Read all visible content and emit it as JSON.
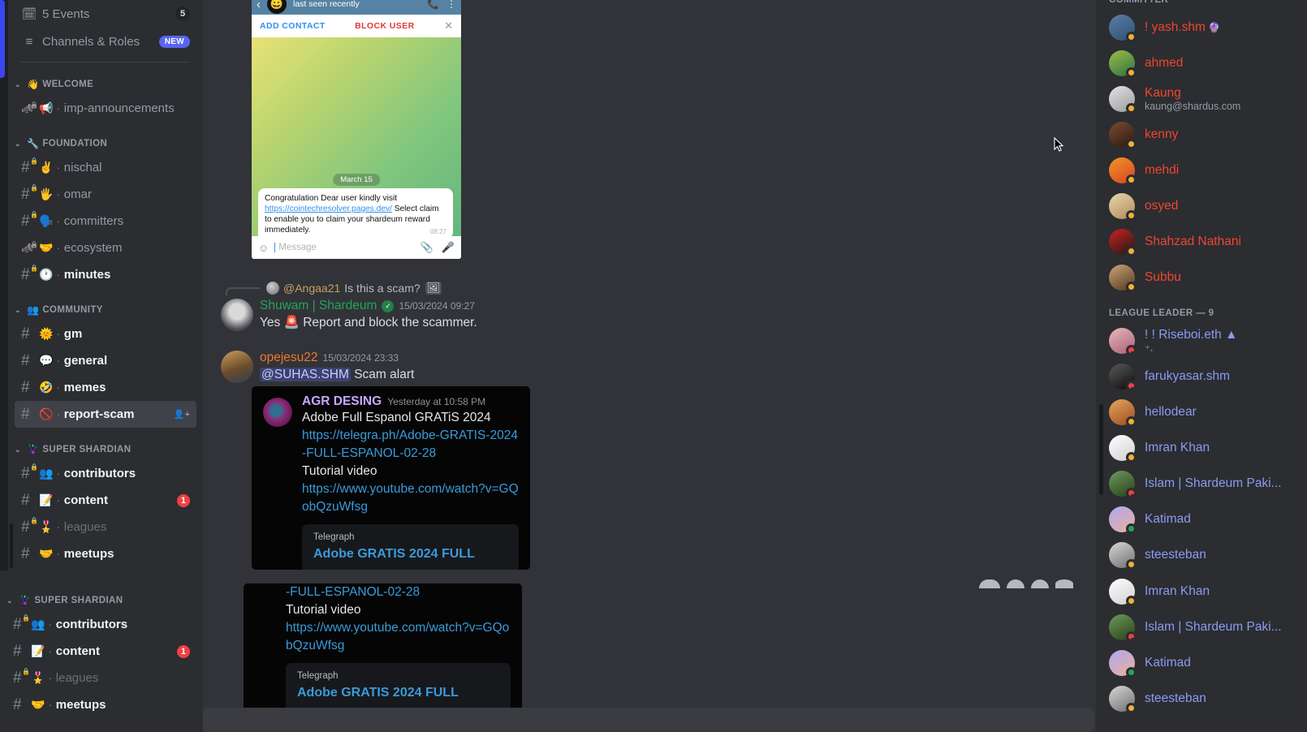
{
  "sidebar": {
    "top_items": [
      {
        "label": "5 Events",
        "icon": "calendar-icon",
        "badge": "5",
        "badge_type": "count"
      },
      {
        "label": "Channels & Roles",
        "icon": "channels-roles-icon",
        "badge": "NEW",
        "badge_type": "new"
      }
    ],
    "categories": [
      {
        "name": "WELCOME",
        "emoji": "👋",
        "channels": [
          {
            "name": "imp-announcements",
            "emoji": "📢",
            "icon": "announcement-channel-icon",
            "locked": true,
            "style": "normal"
          }
        ]
      },
      {
        "name": "FOUNDATION",
        "emoji": "🔧",
        "channels": [
          {
            "name": "nischal",
            "emoji": "✌️",
            "icon": "hash-icon",
            "locked": true,
            "style": "normal"
          },
          {
            "name": "omar",
            "emoji": "🖐️",
            "icon": "hash-icon",
            "locked": true,
            "style": "normal"
          },
          {
            "name": "committers",
            "emoji": "🗣️",
            "icon": "hash-icon",
            "locked": true,
            "style": "normal"
          },
          {
            "name": "ecosystem",
            "emoji": "🤝",
            "icon": "announcement-channel-icon",
            "locked": true,
            "style": "normal"
          },
          {
            "name": "minutes",
            "emoji": "🕐",
            "icon": "hash-icon",
            "locked": true,
            "style": "bold"
          }
        ]
      },
      {
        "name": "COMMUNITY",
        "emoji": "👥",
        "channels": [
          {
            "name": "gm",
            "emoji": "🌞",
            "icon": "hash-icon",
            "locked": false,
            "style": "bold"
          },
          {
            "name": "general",
            "emoji": "💬",
            "icon": "hash-icon",
            "locked": false,
            "style": "bold"
          },
          {
            "name": "memes",
            "emoji": "🤣",
            "icon": "hash-icon",
            "locked": false,
            "style": "bold"
          },
          {
            "name": "report-scam",
            "emoji": "🚫",
            "icon": "hash-icon",
            "locked": false,
            "style": "bold",
            "active": true,
            "trailing_icon": "add-member-icon"
          }
        ]
      },
      {
        "name": "SUPER SHARDIAN",
        "emoji": "🦹",
        "channels": [
          {
            "name": "contributors",
            "emoji": "👥",
            "icon": "hash-icon",
            "locked": true,
            "style": "bold"
          },
          {
            "name": "content",
            "emoji": "📝",
            "icon": "hash-icon",
            "locked": false,
            "style": "bold",
            "badge": "1"
          },
          {
            "name": "leagues",
            "emoji": "🎖️",
            "icon": "hash-icon",
            "locked": true,
            "style": "muted"
          },
          {
            "name": "meetups",
            "emoji": "🤝",
            "icon": "hash-icon",
            "locked": false,
            "style": "bold"
          }
        ]
      }
    ],
    "overlay_category": {
      "name": "SUPER SHARDIAN",
      "emoji": "🦹",
      "channels": [
        {
          "name": "contributors",
          "emoji": "👥",
          "icon": "hash-icon",
          "locked": true,
          "style": "bold"
        },
        {
          "name": "content",
          "emoji": "📝",
          "icon": "hash-icon",
          "locked": false,
          "style": "bold",
          "badge": "1"
        },
        {
          "name": "leagues",
          "emoji": "🎖️",
          "icon": "hash-icon",
          "locked": true,
          "style": "muted"
        },
        {
          "name": "meetups",
          "emoji": "🤝",
          "icon": "hash-icon",
          "locked": false,
          "style": "bold"
        }
      ]
    }
  },
  "telegram_screenshot": {
    "header": {
      "status": "last seen recently",
      "back_icon": "back-arrow-icon",
      "call_icon": "phone-icon",
      "menu_icon": "kebab-menu-icon"
    },
    "action_bar": {
      "add_contact": "ADD CONTACT",
      "block_user": "BLOCK USER",
      "close_icon": "close-icon"
    },
    "date_separator": "March 15",
    "message": {
      "text_before": "Congratulation Dear user kindly visit ",
      "link": "https://cointechresolver.pages.dev/",
      "text_after": " Select claim to enable you to claim your shardeum reward immediately.",
      "time": "08:27"
    },
    "composer": {
      "placeholder": "Message",
      "emoji_icon": "smiley-icon",
      "attach_icon": "paperclip-icon",
      "mic_icon": "microphone-icon"
    }
  },
  "chat": {
    "reply_preview": {
      "user": "@Angaa21",
      "text": "Is this a scam?",
      "attachment_icon": "image-icon"
    },
    "messages": [
      {
        "author": "Shuwam | Shardeum",
        "author_color": "#23a55a",
        "verified_badge": "✓",
        "timestamp": "15/03/2024 09:27",
        "text": "Yes 🚨 Report and block the scammer."
      },
      {
        "author": "opejesu22",
        "author_color": "#f0772b",
        "timestamp": "15/03/2024 23:33",
        "mention": "@SUHAS.SHM",
        "text": "Scam alart"
      }
    ],
    "forwarded_embed": {
      "name": "AGR DESING",
      "timestamp": "Yesterday at 10:58 PM",
      "title": "Adobe Full Espanol GRATiS 2024",
      "link1": "https://telegra.ph/Adobe-GRATIS-2024-FULL-ESPANOL-02-28",
      "label": "Tutorial video",
      "link2": "https://www.youtube.com/watch?v=GQobQzuWfsg",
      "card": {
        "source": "Telegraph",
        "title": "Adobe GRATIS 2024 FULL"
      }
    }
  },
  "members": {
    "sections": [
      {
        "title": "COMMITTER",
        "people": [
          {
            "name": "! yash.shm",
            "color": "#f0462d",
            "status": "idle",
            "badge_icon": "gem-icon",
            "avatar_from": "#5a7fa8",
            "avatar_to": "#2f4f6f"
          },
          {
            "name": "ahmed",
            "color": "#f0462d",
            "status": "idle",
            "avatar_from": "#9cc04a",
            "avatar_to": "#2e6f3c"
          },
          {
            "name": "Kaung",
            "color": "#f0462d",
            "status": "idle",
            "subtitle": "kaung@shardus.com",
            "avatar_from": "#e4e4e4",
            "avatar_to": "#9a9a9a"
          },
          {
            "name": "kenny",
            "color": "#f0462d",
            "status": "idle",
            "avatar_from": "#7a4b32",
            "avatar_to": "#2b1810"
          },
          {
            "name": "mehdi",
            "color": "#f0462d",
            "status": "idle",
            "avatar_from": "#f0962a",
            "avatar_to": "#d9431f"
          },
          {
            "name": "osyed",
            "color": "#f0462d",
            "status": "idle",
            "avatar_from": "#e8d6b0",
            "avatar_to": "#b08a55"
          },
          {
            "name": "Shahzad Nathani",
            "color": "#f0462d",
            "status": "idle",
            "avatar_from": "#d02020",
            "avatar_to": "#1a1a1a"
          },
          {
            "name": "Subbu",
            "color": "#f0462d",
            "status": "idle",
            "avatar_from": "#caa777",
            "avatar_to": "#53351f"
          }
        ]
      },
      {
        "title": "LEAGUE LEADER — 9",
        "people": [
          {
            "name": "! ! Riseboi.eth ▲",
            "color": "#8a9bf0",
            "status": "dnd",
            "subtitle": "⁺˖",
            "avatar_from": "#e8b8c0",
            "avatar_to": "#a85f73"
          },
          {
            "name": "farukyasar.shm",
            "color": "#8a9bf0",
            "status": "dnd",
            "avatar_from": "#5a5a5a",
            "avatar_to": "#0c0c0c"
          },
          {
            "name": "hellodear",
            "color": "#8a9bf0",
            "status": "idle",
            "avatar_from": "#e8a65a",
            "avatar_to": "#9c4a22"
          },
          {
            "name": "Imran Khan",
            "color": "#8a9bf0",
            "status": "idle",
            "avatar_from": "#ffffff",
            "avatar_to": "#cfcfcf"
          },
          {
            "name": "Islam | Shardeum Paki...",
            "color": "#8a9bf0",
            "status": "dnd",
            "avatar_from": "#6f9a5a",
            "avatar_to": "#27401c"
          },
          {
            "name": "Katimad",
            "color": "#8a9bf0",
            "status": "online",
            "avatar_from": "#b0a8f0",
            "avatar_to": "#e8b09a"
          },
          {
            "name": "steesteban",
            "color": "#8a9bf0",
            "status": "idle",
            "avatar_from": "#d8d8d8",
            "avatar_to": "#6e6e6e"
          }
        ]
      }
    ],
    "overlay_people": [
      {
        "name": "Imran Khan",
        "color": "#8a9bf0",
        "status": "idle",
        "avatar_from": "#ffffff",
        "avatar_to": "#cfcfcf"
      },
      {
        "name": "Islam | Shardeum Paki...",
        "color": "#8a9bf0",
        "status": "dnd",
        "avatar_from": "#6f9a5a",
        "avatar_to": "#27401c"
      },
      {
        "name": "Katimad",
        "color": "#8a9bf0",
        "status": "online",
        "avatar_from": "#b0a8f0",
        "avatar_to": "#e8b09a"
      },
      {
        "name": "steesteban",
        "color": "#8a9bf0",
        "status": "idle",
        "avatar_from": "#d8d8d8",
        "avatar_to": "#6e6e6e"
      }
    ]
  },
  "colors": {
    "sidebar_bg": "#2b2d31",
    "chat_bg": "#313338",
    "rail_bg": "#1e1f22",
    "accent": "#5865f2",
    "danger": "#f23f43",
    "online": "#23a55a",
    "idle": "#f0b232"
  }
}
